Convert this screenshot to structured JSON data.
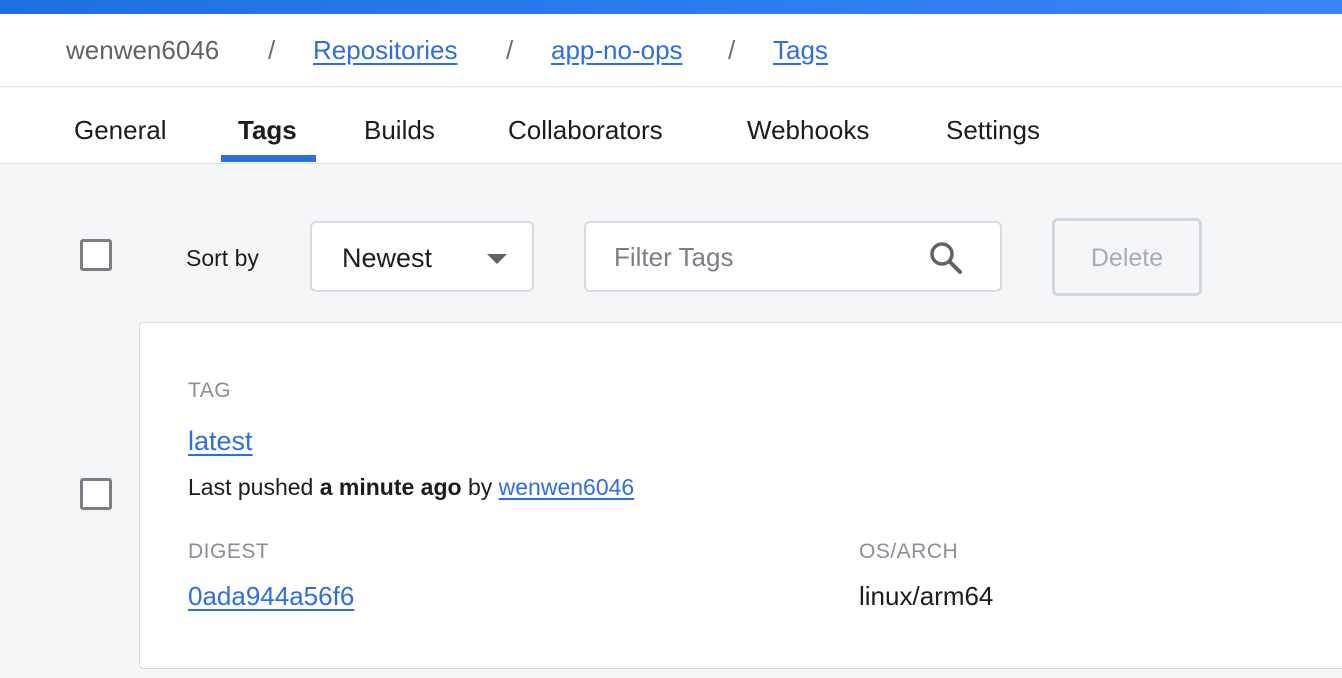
{
  "breadcrumb": {
    "owner": "wenwen6046",
    "separator": "/",
    "repositories": "Repositories",
    "repo": "app-no-ops",
    "current": "Tags"
  },
  "tabs": [
    {
      "label": "General"
    },
    {
      "label": "Tags"
    },
    {
      "label": "Builds"
    },
    {
      "label": "Collaborators"
    },
    {
      "label": "Webhooks"
    },
    {
      "label": "Settings"
    }
  ],
  "active_tab": "Tags",
  "toolbar": {
    "sort_label": "Sort by",
    "sort_value": "Newest",
    "filter_placeholder": "Filter Tags",
    "delete_label": "Delete"
  },
  "tag_card": {
    "tag_label": "TAG",
    "tag_name": "latest",
    "pushed_prefix": "Last pushed",
    "pushed_time": "a minute ago",
    "pushed_by_word": "by",
    "pushed_by_user": "wenwen6046",
    "digest_label": "DIGEST",
    "digest_value": "0ada944a56f6",
    "os_arch_label": "OS/ARCH",
    "os_arch_value": "linux/arm64"
  },
  "colors": {
    "accent": "#2f6ee0",
    "page_background": "#f5f6f7"
  },
  "icons": {
    "search": "search-icon",
    "dropdown": "chevron-down-icon"
  }
}
